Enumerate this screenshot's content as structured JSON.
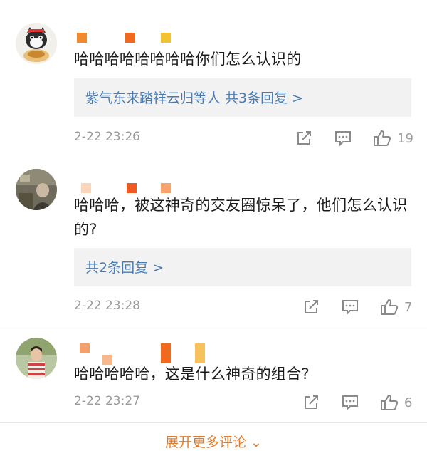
{
  "comments": [
    {
      "text": "哈哈哈哈哈哈哈哈你们怎么认识的",
      "reply_summary": "紫气东来踏祥云归等人 共3条回复 >",
      "time": "2-22 23:26",
      "likes": "19"
    },
    {
      "text": "哈哈哈，被这神奇的交友圈惊呆了，他们怎么认识的?",
      "reply_summary": "共2条回复 >",
      "time": "2-22 23:28",
      "likes": "7"
    },
    {
      "text": "哈哈哈哈哈，这是什么神奇的组合?",
      "time": "2-22 23:27",
      "likes": "6"
    }
  ],
  "footer": {
    "more_label": "展开更多评论 ⌄"
  },
  "icons": {
    "share": "share-icon",
    "comment": "comment-icon",
    "like": "thumbs-up-icon"
  },
  "colors": {
    "link": "#4a7bb0",
    "more": "#e07a2a",
    "meta": "#9a9a9a"
  }
}
